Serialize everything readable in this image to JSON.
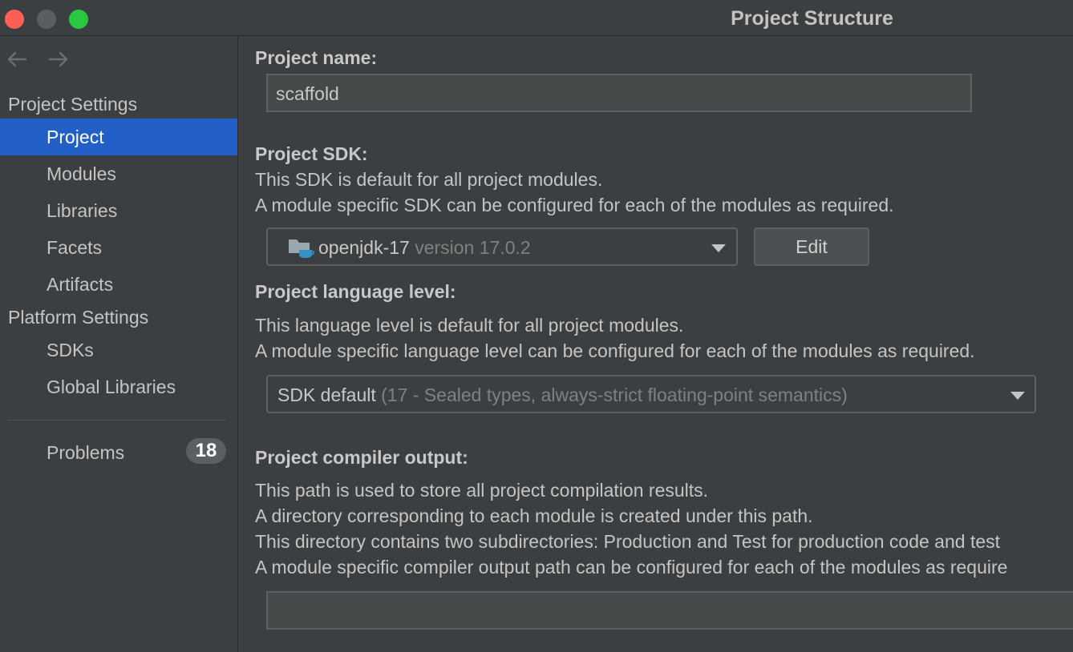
{
  "window": {
    "title": "Project Structure"
  },
  "sidebar": {
    "section_project": "Project Settings",
    "project_items": [
      {
        "label": "Project"
      },
      {
        "label": "Modules"
      },
      {
        "label": "Libraries"
      },
      {
        "label": "Facets"
      },
      {
        "label": "Artifacts"
      }
    ],
    "section_platform": "Platform Settings",
    "platform_items": [
      {
        "label": "SDKs"
      },
      {
        "label": "Global Libraries"
      }
    ],
    "problems": {
      "label": "Problems",
      "count": "18"
    }
  },
  "main": {
    "project_name": {
      "heading": "Project name:",
      "value": "scaffold"
    },
    "sdk": {
      "heading": "Project SDK:",
      "line1": "This SDK is default for all project modules.",
      "line2": "A module specific SDK can be configured for each of the modules as required.",
      "selected_name": "openjdk-17",
      "selected_version": "version 17.0.2",
      "edit_label": "Edit"
    },
    "language_level": {
      "heading": "Project language level:",
      "line1": "This language level is default for all project modules.",
      "line2": "A module specific language level can be configured for each of the modules as required.",
      "selected_name": "SDK default",
      "selected_detail": "(17 - Sealed types, always-strict floating-point semantics)"
    },
    "compiler_output": {
      "heading": "Project compiler output:",
      "line1": "This path is used to store all project compilation results.",
      "line2": "A directory corresponding to each module is created under this path.",
      "line3": "This directory contains two subdirectories: Production and Test for production code and test",
      "line4": "A module specific compiler output path can be configured for each of the modules as require",
      "value": ""
    }
  },
  "colors": {
    "selection": "#2260c8",
    "background": "#3c3f41",
    "close": "#fe5f57",
    "zoom": "#28c840"
  }
}
